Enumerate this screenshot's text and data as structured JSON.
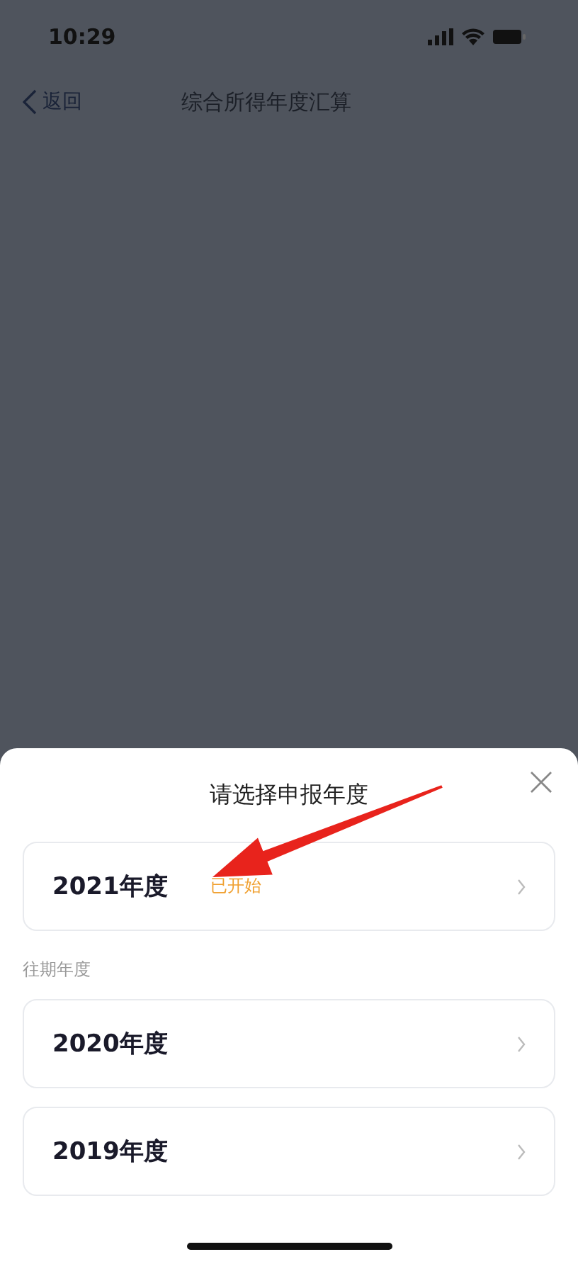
{
  "status_bar": {
    "time": "10:29"
  },
  "nav_bar": {
    "back": "返回",
    "title": "综合所得年度汇算"
  },
  "sheet": {
    "title": "请选择申报年度",
    "current": [
      {
        "year": "2021年度",
        "status": "已开始"
      }
    ],
    "past_label": "往期年度",
    "past": [
      {
        "year": "2020年度"
      },
      {
        "year": "2019年度"
      }
    ]
  }
}
